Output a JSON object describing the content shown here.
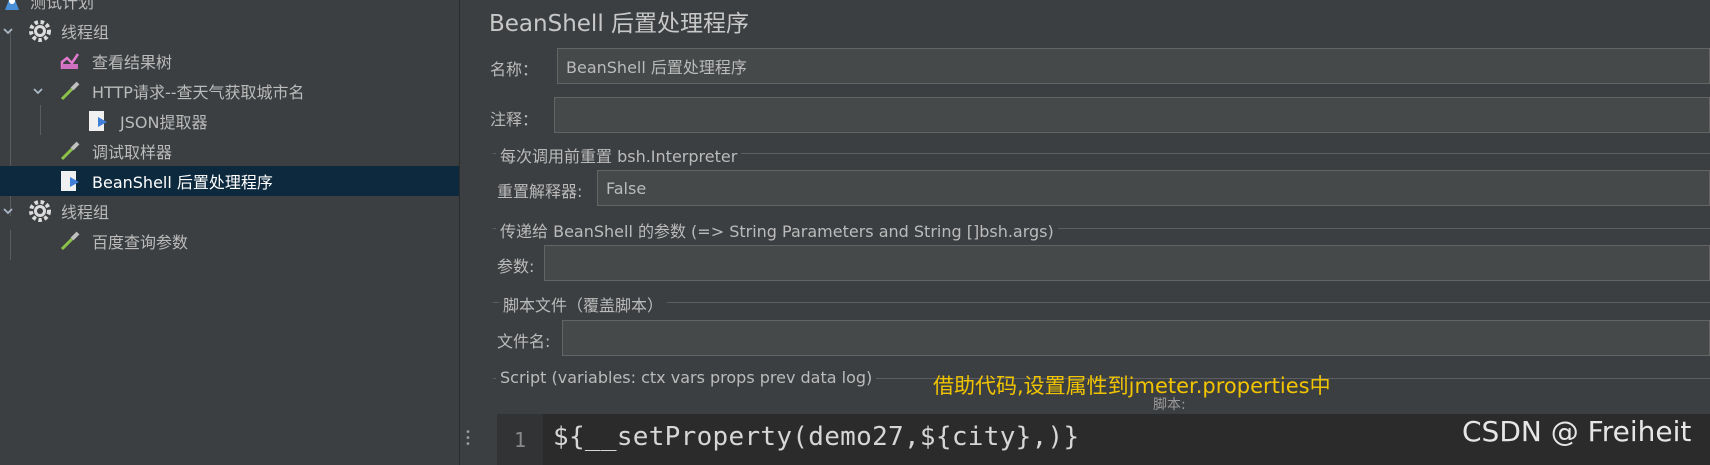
{
  "tree": {
    "items": [
      {
        "label": "测试计划",
        "icon": "test-plan-icon"
      },
      {
        "label": "线程组",
        "icon": "gear-icon"
      },
      {
        "label": "查看结果树",
        "icon": "chart-icon"
      },
      {
        "label": "HTTP请求--查天气获取城市名",
        "icon": "pipette-icon"
      },
      {
        "label": "JSON提取器",
        "icon": "document-icon"
      },
      {
        "label": "调试取样器",
        "icon": "pipette-icon"
      },
      {
        "label": "BeanShell 后置处理程序",
        "icon": "document-icon"
      },
      {
        "label": "线程组",
        "icon": "gear-icon"
      },
      {
        "label": "百度查询参数",
        "icon": "pipette-icon"
      }
    ]
  },
  "panel": {
    "title": "BeanShell 后置处理程序",
    "name_label": "名称：",
    "name_value": "BeanShell 后置处理程序",
    "comment_label": "注释：",
    "comment_value": "",
    "reset_section": "每次调用前重置 bsh.Interpreter",
    "reset_label": "重置解释器:",
    "reset_value": "False",
    "params_section": "传递给 BeanShell 的参数 (=> String Parameters and String []bsh.args)",
    "params_label": "参数:",
    "params_value": "",
    "file_section": "脚本文件（覆盖脚本）",
    "file_label": "文件名:",
    "file_value": "",
    "script_section": "Script (variables: ctx vars props prev data log)",
    "script_label": "脚本:",
    "line_number": "1",
    "code": "${__setProperty(demo27,${city},)}"
  },
  "annotation": "借助代码,设置属性到jmeter.properties中",
  "watermark": "CSDN @ Freiheit",
  "colors": {
    "background": "#3c3f41",
    "selected_row": "#0d293e",
    "annotation": "#f2c400",
    "field_bg": "#45494a"
  }
}
